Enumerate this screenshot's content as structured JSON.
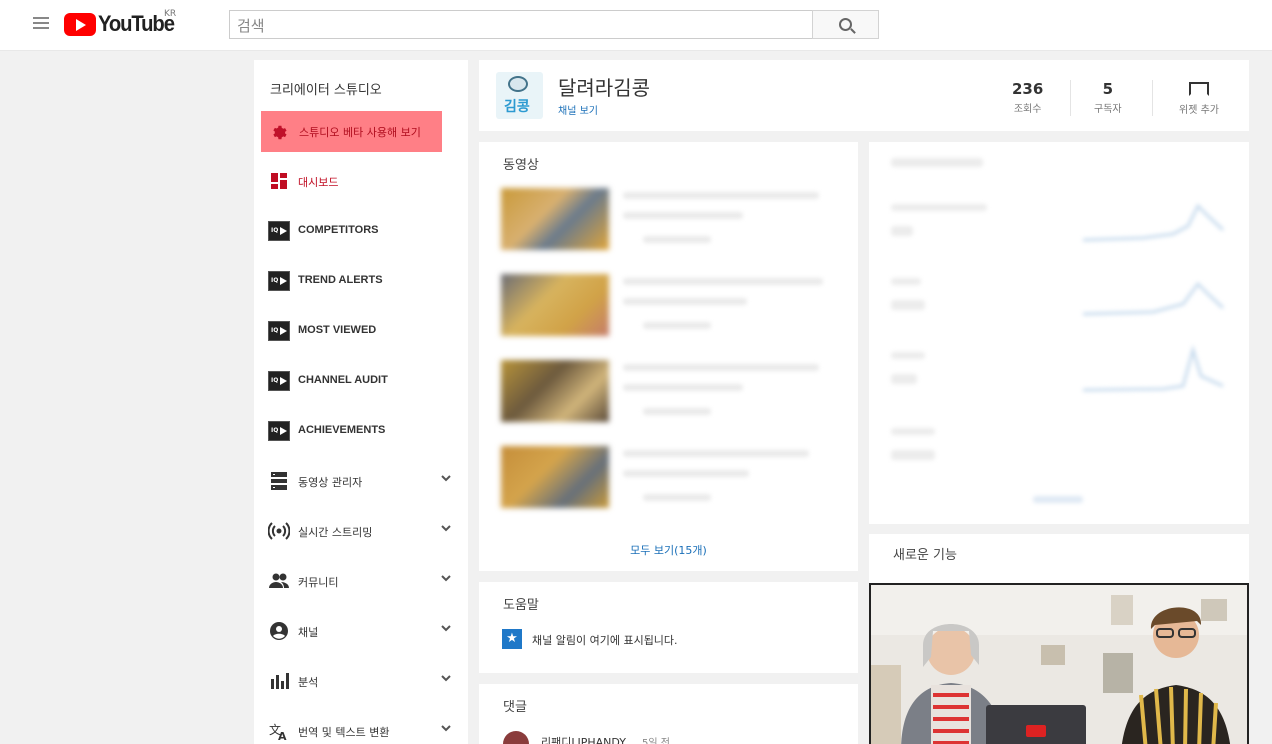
{
  "header": {
    "logo_text": "YouTube",
    "region": "KR",
    "search_placeholder": "검색"
  },
  "sidebar": {
    "title": "크리에이터 스튜디오",
    "beta_label": "스튜디오 베타 사용해 보기",
    "items": [
      {
        "label": "대시보드",
        "icon": "dashboard-icon"
      },
      {
        "label": "COMPETITORS",
        "icon": "vidiq-icon"
      },
      {
        "label": "TREND ALERTS",
        "icon": "vidiq-icon"
      },
      {
        "label": "MOST VIEWED",
        "icon": "vidiq-icon"
      },
      {
        "label": "CHANNEL AUDIT",
        "icon": "vidiq-icon"
      },
      {
        "label": "ACHIEVEMENTS",
        "icon": "vidiq-icon"
      },
      {
        "label": "동영상 관리자",
        "icon": "video-manager-icon"
      },
      {
        "label": "실시간 스트리밍",
        "icon": "live-icon"
      },
      {
        "label": "커뮤니티",
        "icon": "community-icon"
      },
      {
        "label": "채널",
        "icon": "channel-icon"
      },
      {
        "label": "분석",
        "icon": "analytics-icon"
      },
      {
        "label": "번역 및 텍스트 변환",
        "icon": "translate-icon"
      }
    ]
  },
  "channel": {
    "name": "달려라김콩",
    "avatar_text": "김콩",
    "view_link": "채널 보기",
    "stats": [
      {
        "value": "236",
        "label": "조회수"
      },
      {
        "value": "5",
        "label": "구독자"
      }
    ],
    "add_widget_label": "위젯 추가"
  },
  "videos": {
    "title": "동영상",
    "see_all": "모두 보기(15개)"
  },
  "help": {
    "title": "도움말",
    "message": "채널 알림이 여기에 표시됩니다."
  },
  "comments": {
    "title": "댓글",
    "author": "리팬디LIPHANDY",
    "time": "5일 전"
  },
  "new_features": {
    "title": "새로운 기능"
  },
  "colors": {
    "beta_highlight": "#ff7f86",
    "dashboard_red": "#c00d23",
    "link_blue": "#1a6fb8"
  }
}
